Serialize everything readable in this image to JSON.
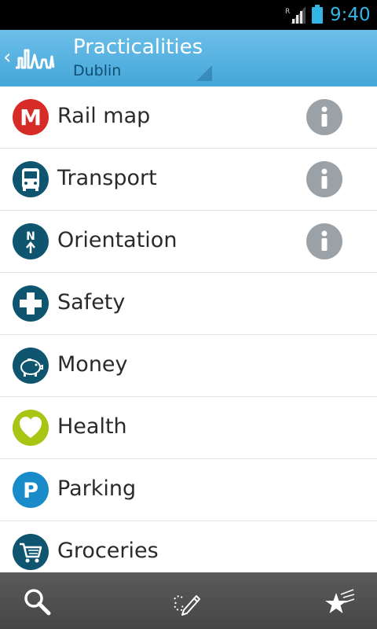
{
  "status_bar": {
    "time": "9:40",
    "network_indicator": "R",
    "icons": [
      "signal-icon",
      "battery-icon"
    ]
  },
  "header": {
    "title": "Practicalities",
    "subtitle": "Dublin",
    "back_icon": "chevron-left-icon",
    "logo_icon": "skyline-logo-icon",
    "background": "#58b1e0"
  },
  "items": [
    {
      "label": "Rail map",
      "icon": "metro-m-icon",
      "icon_color": "#d62b27",
      "has_info": true
    },
    {
      "label": "Transport",
      "icon": "bus-icon",
      "icon_color": "#10556f",
      "has_info": true
    },
    {
      "label": "Orientation",
      "icon": "compass-north-icon",
      "icon_color": "#10556f",
      "has_info": true
    },
    {
      "label": "Safety",
      "icon": "cross-icon",
      "icon_color": "#10556f",
      "has_info": false
    },
    {
      "label": "Money",
      "icon": "piggy-bank-icon",
      "icon_color": "#10556f",
      "has_info": false
    },
    {
      "label": "Health",
      "icon": "heart-icon",
      "icon_color": "#a9c413",
      "has_info": false
    },
    {
      "label": "Parking",
      "icon": "parking-p-icon",
      "icon_color": "#1a8bc9",
      "has_info": false
    },
    {
      "label": "Groceries",
      "icon": "shopping-cart-icon",
      "icon_color": "#10556f",
      "has_info": false
    }
  ],
  "info_icon": "info-icon",
  "bottom_bar": {
    "buttons": [
      "search-icon",
      "route-pencil-icon",
      "favorites-stars-icon"
    ]
  }
}
